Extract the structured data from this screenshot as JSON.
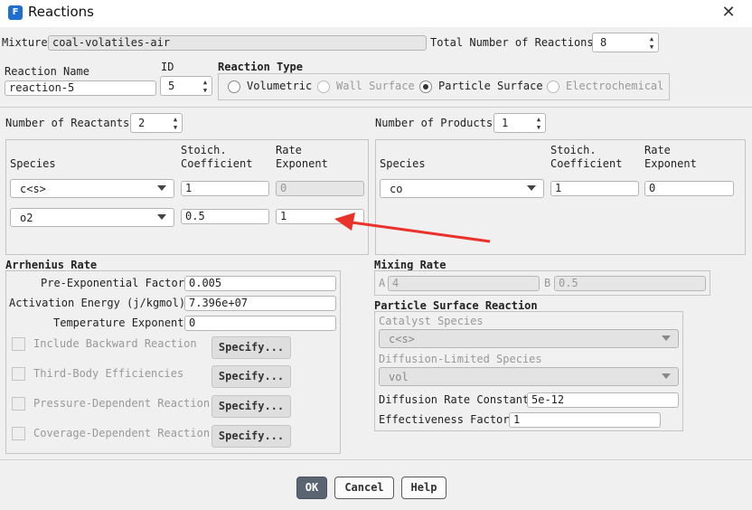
{
  "window": {
    "title": "Reactions",
    "app_icon_letter": "F"
  },
  "mixture": {
    "label": "Mixture",
    "value": "coal-volatiles-air"
  },
  "total_reactions": {
    "label": "Total Number of Reactions",
    "value": "8"
  },
  "reaction_name": {
    "label": "Reaction Name",
    "value": "reaction-5"
  },
  "id": {
    "label": "ID",
    "value": "5"
  },
  "reaction_type": {
    "label": "Reaction Type",
    "options": [
      "Volumetric",
      "Wall Surface",
      "Particle Surface",
      "Electrochemical"
    ],
    "selected": "Particle Surface"
  },
  "reactants": {
    "count_label": "Number of Reactants",
    "count": "2",
    "headers": {
      "species": "Species",
      "stoich": [
        "Stoich.",
        "Coefficient"
      ],
      "rate": [
        "Rate",
        "Exponent"
      ]
    },
    "rows": [
      {
        "species": "c<s>",
        "stoich": "1",
        "rate": "0"
      },
      {
        "species": "o2",
        "stoich": "0.5",
        "rate": "1"
      }
    ]
  },
  "products": {
    "count_label": "Number of Products",
    "count": "1",
    "headers": {
      "species": "Species",
      "stoich": [
        "Stoich.",
        "Coefficient"
      ],
      "rate": [
        "Rate",
        "Exponent"
      ]
    },
    "rows": [
      {
        "species": "co",
        "stoich": "1",
        "rate": "0"
      }
    ]
  },
  "arrhenius": {
    "title": "Arrhenius Rate",
    "pre_exp_label": "Pre-Exponential Factor",
    "pre_exp_value": "0.005",
    "act_energy_label": "Activation Energy (j/kgmol)",
    "act_energy_value": "7.396e+07",
    "temp_exp_label": "Temperature Exponent",
    "temp_exp_value": "0",
    "options": [
      "Include Backward Reaction",
      "Third-Body Efficiencies",
      "Pressure-Dependent Reaction",
      "Coverage-Dependent Reaction"
    ],
    "specify_label": "Specify..."
  },
  "mixing_rate": {
    "title": "Mixing Rate",
    "a_label": "A",
    "a_value": "4",
    "b_label": "B",
    "b_value": "0.5"
  },
  "particle_surface": {
    "title": "Particle Surface Reaction",
    "catalyst_label": "Catalyst Species",
    "catalyst_value": "c<s>",
    "diffusion_species_label": "Diffusion-Limited Species",
    "diffusion_species_value": "vol",
    "diffusion_rate_label": "Diffusion Rate Constant",
    "diffusion_rate_value": "5e-12",
    "effectiveness_label": "Effectiveness Factor",
    "effectiveness_value": "1"
  },
  "buttons": {
    "ok": "OK",
    "cancel": "Cancel",
    "help": "Help"
  },
  "annotation": {
    "arrow_color": "#e8322a"
  }
}
